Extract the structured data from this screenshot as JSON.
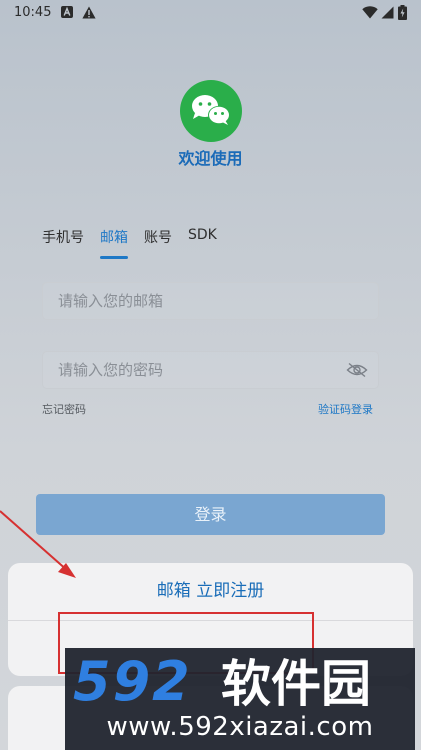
{
  "status_bar": {
    "time": "10:45",
    "left_icons": [
      "a-box-icon",
      "warning-icon"
    ],
    "right_icons": [
      "wifi-icon",
      "signal-icon",
      "battery-charging-icon"
    ]
  },
  "app": {
    "logo_icon": "wechat-logo-icon",
    "welcome": "欢迎使用",
    "accent_color": "#1e78c6"
  },
  "login_tabs": {
    "items": [
      {
        "label": "手机号",
        "active": false
      },
      {
        "label": "邮箱",
        "active": true
      },
      {
        "label": "账号",
        "active": false
      },
      {
        "label": "SDK",
        "active": false
      }
    ]
  },
  "form": {
    "email_placeholder": "请输入您的邮箱",
    "email_value": "",
    "password_placeholder": "请输入您的密码",
    "password_value": "",
    "password_toggle_icon": "eye-off-icon",
    "forgot_password": "忘记密码",
    "code_login": "验证码登录",
    "login_button": "登录"
  },
  "bottom_sheet": {
    "register_email": "邮箱 立即注册"
  },
  "overlay": {
    "watermark_brand": "592软件园",
    "watermark_url": "www.592xiazai.com",
    "annotation_color": "#d63131"
  }
}
